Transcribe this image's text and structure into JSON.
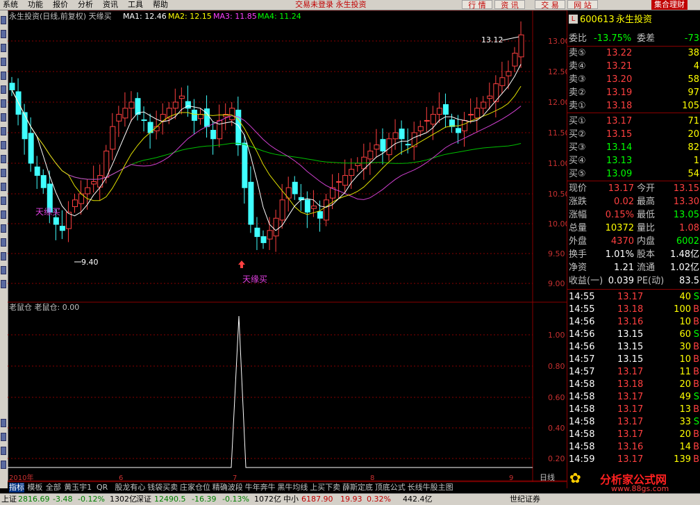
{
  "menu": {
    "items": [
      "系统",
      "功能",
      "报价",
      "分析",
      "资讯",
      "工具",
      "帮助"
    ],
    "notice": "交易未登录  永生投资",
    "right_buttons": [
      "行 情",
      "资 讯",
      "交 易",
      "网 站"
    ],
    "logo": "集合理财"
  },
  "chart": {
    "header": "永生投资(日线,前复权) 天缘买",
    "ma1": "MA1: 12.46",
    "ma2": "MA2: 12.15",
    "ma3": "MA3: 11.85",
    "ma4": "MA4: 11.24",
    "colors": {
      "ma1": "#ffffff",
      "ma2": "#ffff00",
      "ma3": "#ff40ff",
      "ma4": "#00ff00",
      "up": "#ff4040",
      "down": "#40ffff"
    },
    "price_ticks": [
      "13.00",
      "12.50",
      "12.00",
      "11.50",
      "11.00",
      "10.50",
      "10.00",
      "9.50",
      "9.00"
    ],
    "high_label": "13.12",
    "low_label": "9.40",
    "signal_label_1": "天缘买",
    "signal_label_2": "天缘买",
    "sub_header": "老鼠仓 老鼠仓: 0.00",
    "sub_ticks": [
      "1.00",
      "0.80",
      "0.60",
      "0.40",
      "0.20"
    ],
    "date_labels": [
      "2010年",
      "6",
      "7",
      "8",
      "9"
    ],
    "period": "日线"
  },
  "chart_data": {
    "type": "line",
    "title": "永生投资(日线,前复权)",
    "ylim": [
      9.0,
      13.2
    ],
    "series": [
      {
        "name": "MA1",
        "values": [
          12.46
        ]
      },
      {
        "name": "MA2",
        "values": [
          12.15
        ]
      },
      {
        "name": "MA3",
        "values": [
          11.85
        ]
      },
      {
        "name": "MA4",
        "values": [
          11.24
        ]
      }
    ]
  },
  "quote": {
    "code": "600613",
    "name": "永生投资",
    "weibi_label": "委比",
    "weibi": "-13.75%",
    "weicha_label": "委差",
    "weicha": "-73",
    "sells": [
      {
        "label": "卖⑤",
        "price": "13.22",
        "vol": "38"
      },
      {
        "label": "卖④",
        "price": "13.21",
        "vol": "4"
      },
      {
        "label": "卖③",
        "price": "13.20",
        "vol": "58"
      },
      {
        "label": "卖②",
        "price": "13.19",
        "vol": "97"
      },
      {
        "label": "卖①",
        "price": "13.18",
        "vol": "105"
      }
    ],
    "buys": [
      {
        "label": "买①",
        "price": "13.17",
        "vol": "71"
      },
      {
        "label": "买②",
        "price": "13.15",
        "vol": "20"
      },
      {
        "label": "买③",
        "price": "13.14",
        "vol": "82"
      },
      {
        "label": "买④",
        "price": "13.13",
        "vol": "1"
      },
      {
        "label": "买⑤",
        "price": "13.09",
        "vol": "54"
      }
    ],
    "stats": [
      {
        "l1": "现价",
        "v1": "13.17",
        "l2": "今开",
        "v2": "13.15"
      },
      {
        "l1": "涨跌",
        "v1": "0.02",
        "l2": "最高",
        "v2": "13.30"
      },
      {
        "l1": "涨幅",
        "v1": "0.15%",
        "l2": "最低",
        "v2": "13.05"
      },
      {
        "l1": "总量",
        "v1": "10372",
        "l2": "量比",
        "v2": "1.08"
      },
      {
        "l1": "外盘",
        "v1": "4370",
        "l2": "内盘",
        "v2": "6002"
      },
      {
        "l1": "换手",
        "v1": "1.01%",
        "l2": "股本",
        "v2": "1.48亿"
      },
      {
        "l1": "净资",
        "v1": "1.21",
        "l2": "流通",
        "v2": "1.02亿"
      },
      {
        "l1": "收益(一)",
        "v1": "0.039",
        "l2": "PE(动)",
        "v2": "83.5"
      }
    ],
    "ticks": [
      {
        "t": "14:55",
        "p": "13.17",
        "v": "40",
        "d": "S"
      },
      {
        "t": "14:55",
        "p": "13.18",
        "v": "100",
        "d": "B"
      },
      {
        "t": "14:56",
        "p": "13.16",
        "v": "10",
        "d": "B"
      },
      {
        "t": "14:56",
        "p": "13.15",
        "v": "60",
        "d": "S"
      },
      {
        "t": "14:56",
        "p": "13.15",
        "v": "30",
        "d": "B"
      },
      {
        "t": "14:57",
        "p": "13.15",
        "v": "10",
        "d": "B"
      },
      {
        "t": "14:57",
        "p": "13.17",
        "v": "11",
        "d": "B"
      },
      {
        "t": "14:58",
        "p": "13.18",
        "v": "20",
        "d": "B"
      },
      {
        "t": "14:58",
        "p": "13.17",
        "v": "49",
        "d": "S"
      },
      {
        "t": "14:58",
        "p": "13.17",
        "v": "13",
        "d": "B"
      },
      {
        "t": "14:58",
        "p": "13.17",
        "v": "33",
        "d": "S"
      },
      {
        "t": "14:58",
        "p": "13.17",
        "v": "20",
        "d": "B"
      },
      {
        "t": "14:58",
        "p": "13.16",
        "v": "14",
        "d": "B"
      },
      {
        "t": "14:59",
        "p": "13.17",
        "v": "139",
        "d": "B"
      }
    ]
  },
  "tabs": [
    "指标",
    "模板",
    "全部",
    "黄玉宇1",
    "QR",
    "股龙有心",
    "钱袋买卖",
    "庄家仓位",
    "精确波段",
    "牛年奔牛",
    "黑牛均线",
    "上买下卖",
    "薛斯定底",
    "顶底公式",
    "长线牛股主图"
  ],
  "status": {
    "sh_name": "上证",
    "sh": "2816.69",
    "sh_chg": "-3.48",
    "sh_pct": "-0.12%",
    "sh_amt": "1302亿",
    "sz_name": "深证",
    "sz": "12490.5",
    "sz_chg": "-16.39",
    "sz_pct": "-0.13%",
    "sz_amt": "1072亿",
    "zx_name": "中小",
    "zx": "6187.90",
    "zx_chg": "19.93",
    "zx_pct": "0.32%",
    "zx_amt": "442.4亿",
    "broker": "世纪证券"
  },
  "watermark": {
    "site": "分析家公式网",
    "url": "www.88gs.com"
  }
}
